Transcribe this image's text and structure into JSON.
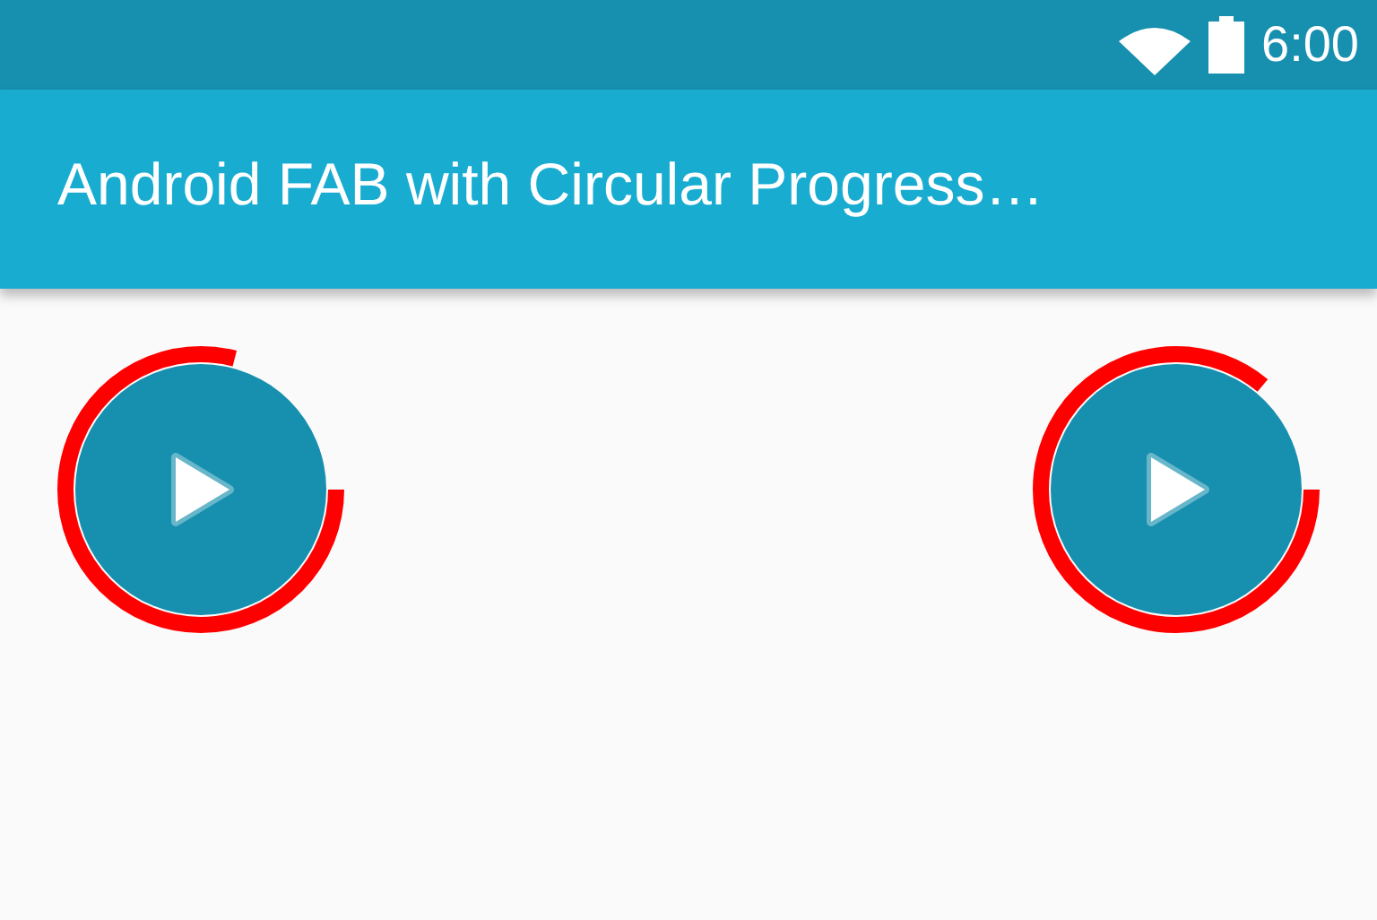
{
  "status_bar": {
    "time": "6:00"
  },
  "toolbar": {
    "title": "Android FAB with Circular Progress…"
  },
  "fabs": [
    {
      "level": 0.79
    },
    {
      "level": 0.86
    }
  ]
}
